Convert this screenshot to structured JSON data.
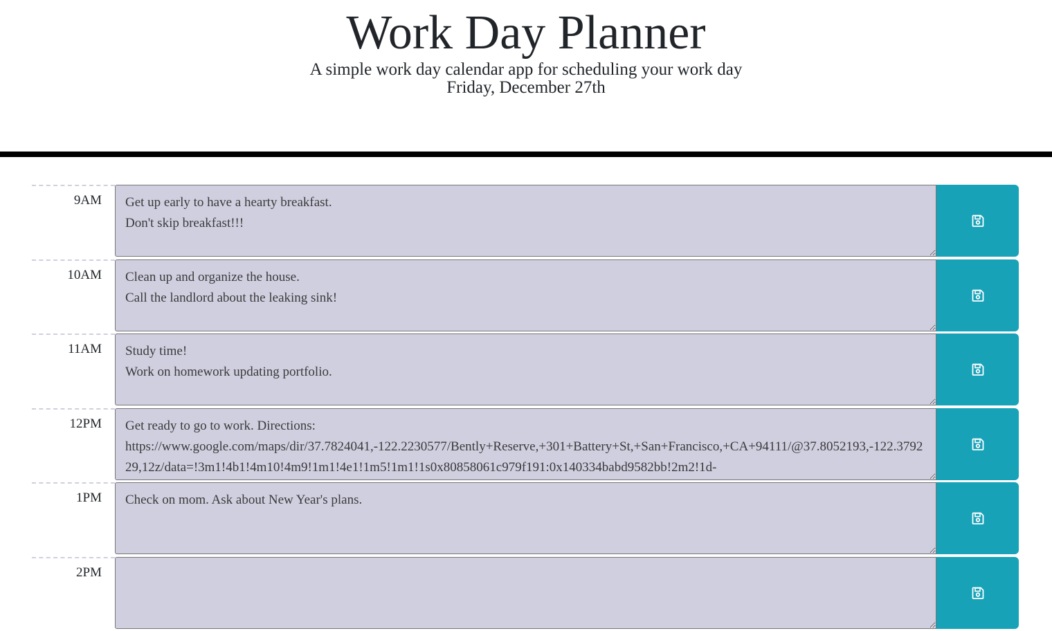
{
  "header": {
    "title": "Work Day Planner",
    "subtitle": "A simple work day calendar app for scheduling your work day",
    "current_day": "Friday, December 27th"
  },
  "colors": {
    "row_bg": "#d0cfe0",
    "save_bg": "#17a2b8",
    "divider": "#000000"
  },
  "icons": {
    "save": "floppy-disk-icon"
  },
  "rows": [
    {
      "hour": "9AM",
      "text": "Get up early to have a hearty breakfast.\nDon't skip breakfast!!!"
    },
    {
      "hour": "10AM",
      "text": "Clean up and organize the house.\nCall the landlord about the leaking sink!"
    },
    {
      "hour": "11AM",
      "text": "Study time!\nWork on homework updating portfolio."
    },
    {
      "hour": "12PM",
      "text": "Get ready to go to work. Directions:\nhttps://www.google.com/maps/dir/37.7824041,-122.2230577/Bently+Reserve,+301+Battery+St,+San+Francisco,+CA+94111/@37.8052193,-122.379229,12z/data=!3m1!4b1!4m10!4m9!1m1!4e1!1m5!1m1!1s0x80858061c979f191:0x140334babd9582bb!2m2!1d-"
    },
    {
      "hour": "1PM",
      "text": "Check on mom. Ask about New Year's plans."
    },
    {
      "hour": "2PM",
      "text": ""
    }
  ]
}
